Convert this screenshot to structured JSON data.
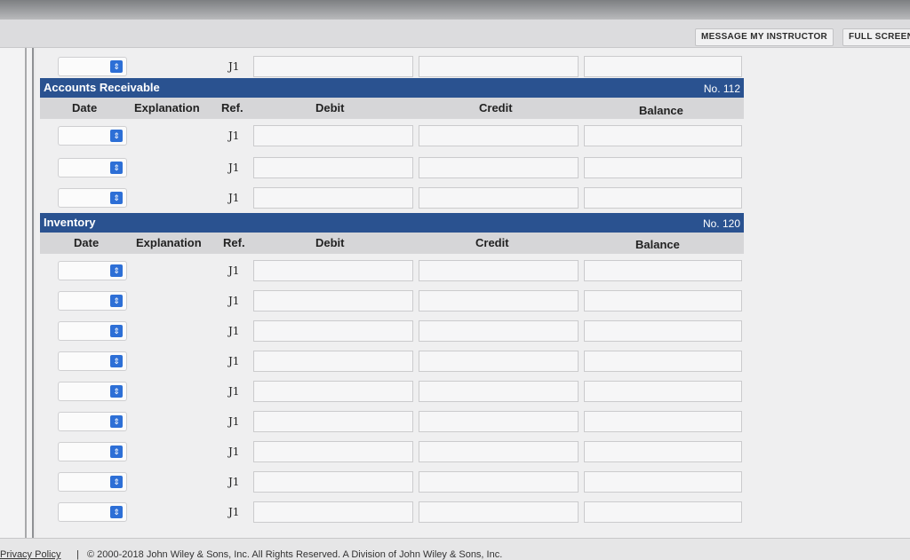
{
  "toolbar": {
    "message_label": "MESSAGE MY INSTRUCTOR",
    "fullscreen_label": "FULL SCREEN"
  },
  "top_row": {
    "ref": "J1"
  },
  "sections": [
    {
      "name": "Accounts Receivable",
      "number": "No. 112",
      "columns": [
        "Date",
        "Explanation",
        "Ref.",
        "Debit",
        "Credit",
        "Balance"
      ],
      "rows": [
        {
          "ref": "J1"
        },
        {
          "ref": "J1"
        },
        {
          "ref": "J1"
        }
      ]
    },
    {
      "name": "Inventory",
      "number": "No. 120",
      "columns": [
        "Date",
        "Explanation",
        "Ref.",
        "Debit",
        "Credit",
        "Balance"
      ],
      "rows": [
        {
          "ref": "J1"
        },
        {
          "ref": "J1"
        },
        {
          "ref": "J1"
        },
        {
          "ref": "J1"
        },
        {
          "ref": "J1"
        },
        {
          "ref": "J1"
        },
        {
          "ref": "J1"
        },
        {
          "ref": "J1"
        },
        {
          "ref": "J1"
        }
      ]
    }
  ],
  "footer": {
    "privacy": "Privacy Policy",
    "separator": "|",
    "copyright": "© 2000-2018 John Wiley & Sons, Inc. All Rights Reserved. A Division of John Wiley & Sons, Inc."
  }
}
